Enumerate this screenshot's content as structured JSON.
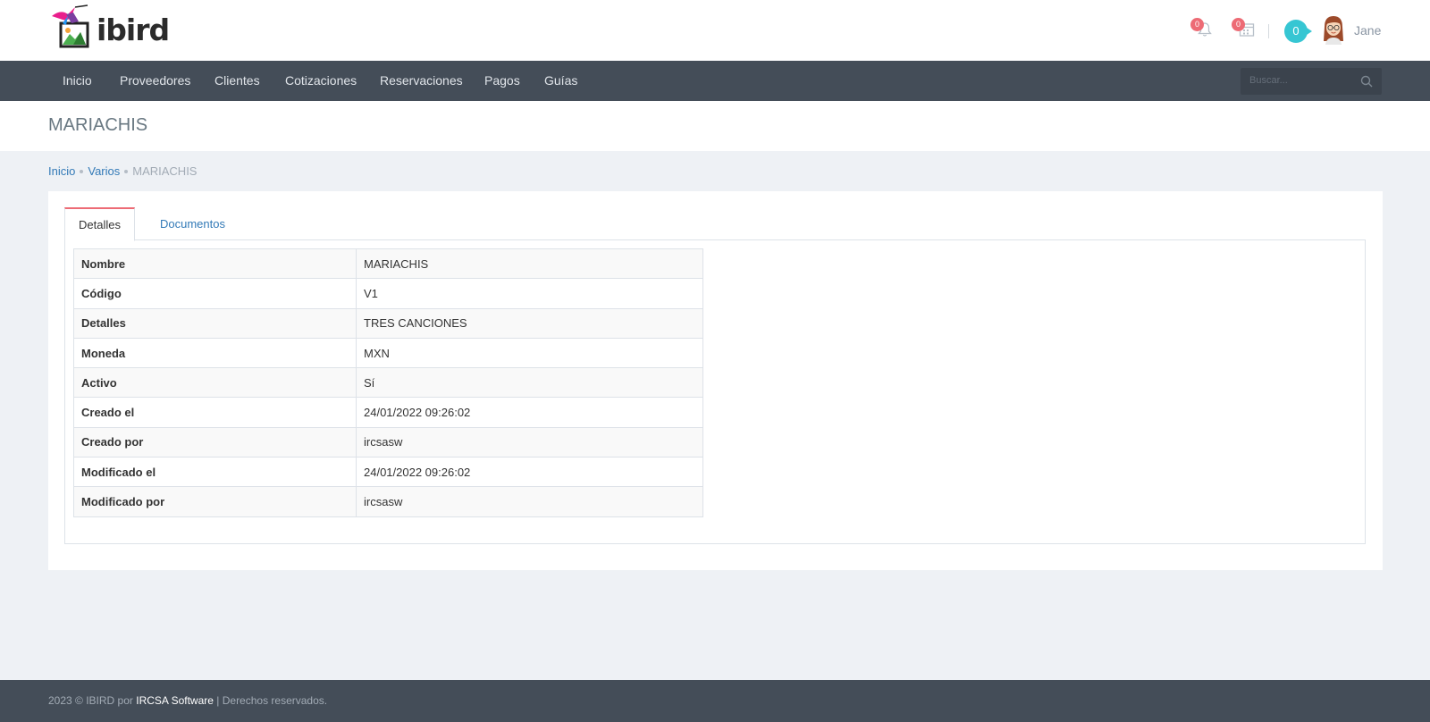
{
  "header": {
    "logo_text": "ibird",
    "notifications_count": "0",
    "tasks_count": "0",
    "inbox_count": "0",
    "username": "Jane"
  },
  "nav": {
    "items": [
      "Inicio",
      "Proveedores",
      "Clientes",
      "Cotizaciones",
      "Reservaciones",
      "Pagos",
      "Guías"
    ],
    "search_placeholder": "Buscar..."
  },
  "page": {
    "title": "MARIACHIS"
  },
  "breadcrumb": {
    "items": [
      "Inicio",
      "Varios"
    ],
    "current": "MARIACHIS"
  },
  "tabs": [
    "Detalles",
    "Documentos"
  ],
  "details": [
    {
      "label": "Nombre",
      "value": "MARIACHIS"
    },
    {
      "label": "Código",
      "value": "V1"
    },
    {
      "label": "Detalles",
      "value": "TRES CANCIONES"
    },
    {
      "label": "Moneda",
      "value": "MXN"
    },
    {
      "label": "Activo",
      "value": "Sí"
    },
    {
      "label": "Creado el",
      "value": "24/01/2022 09:26:02"
    },
    {
      "label": "Creado por",
      "value": "ircsasw"
    },
    {
      "label": "Modificado el",
      "value": "24/01/2022 09:26:02"
    },
    {
      "label": "Modificado por",
      "value": "ircsasw"
    }
  ],
  "footer": {
    "prefix": "2023 © IBIRD por ",
    "brand": "IRCSA Software",
    "suffix": " | Derechos reservados."
  }
}
